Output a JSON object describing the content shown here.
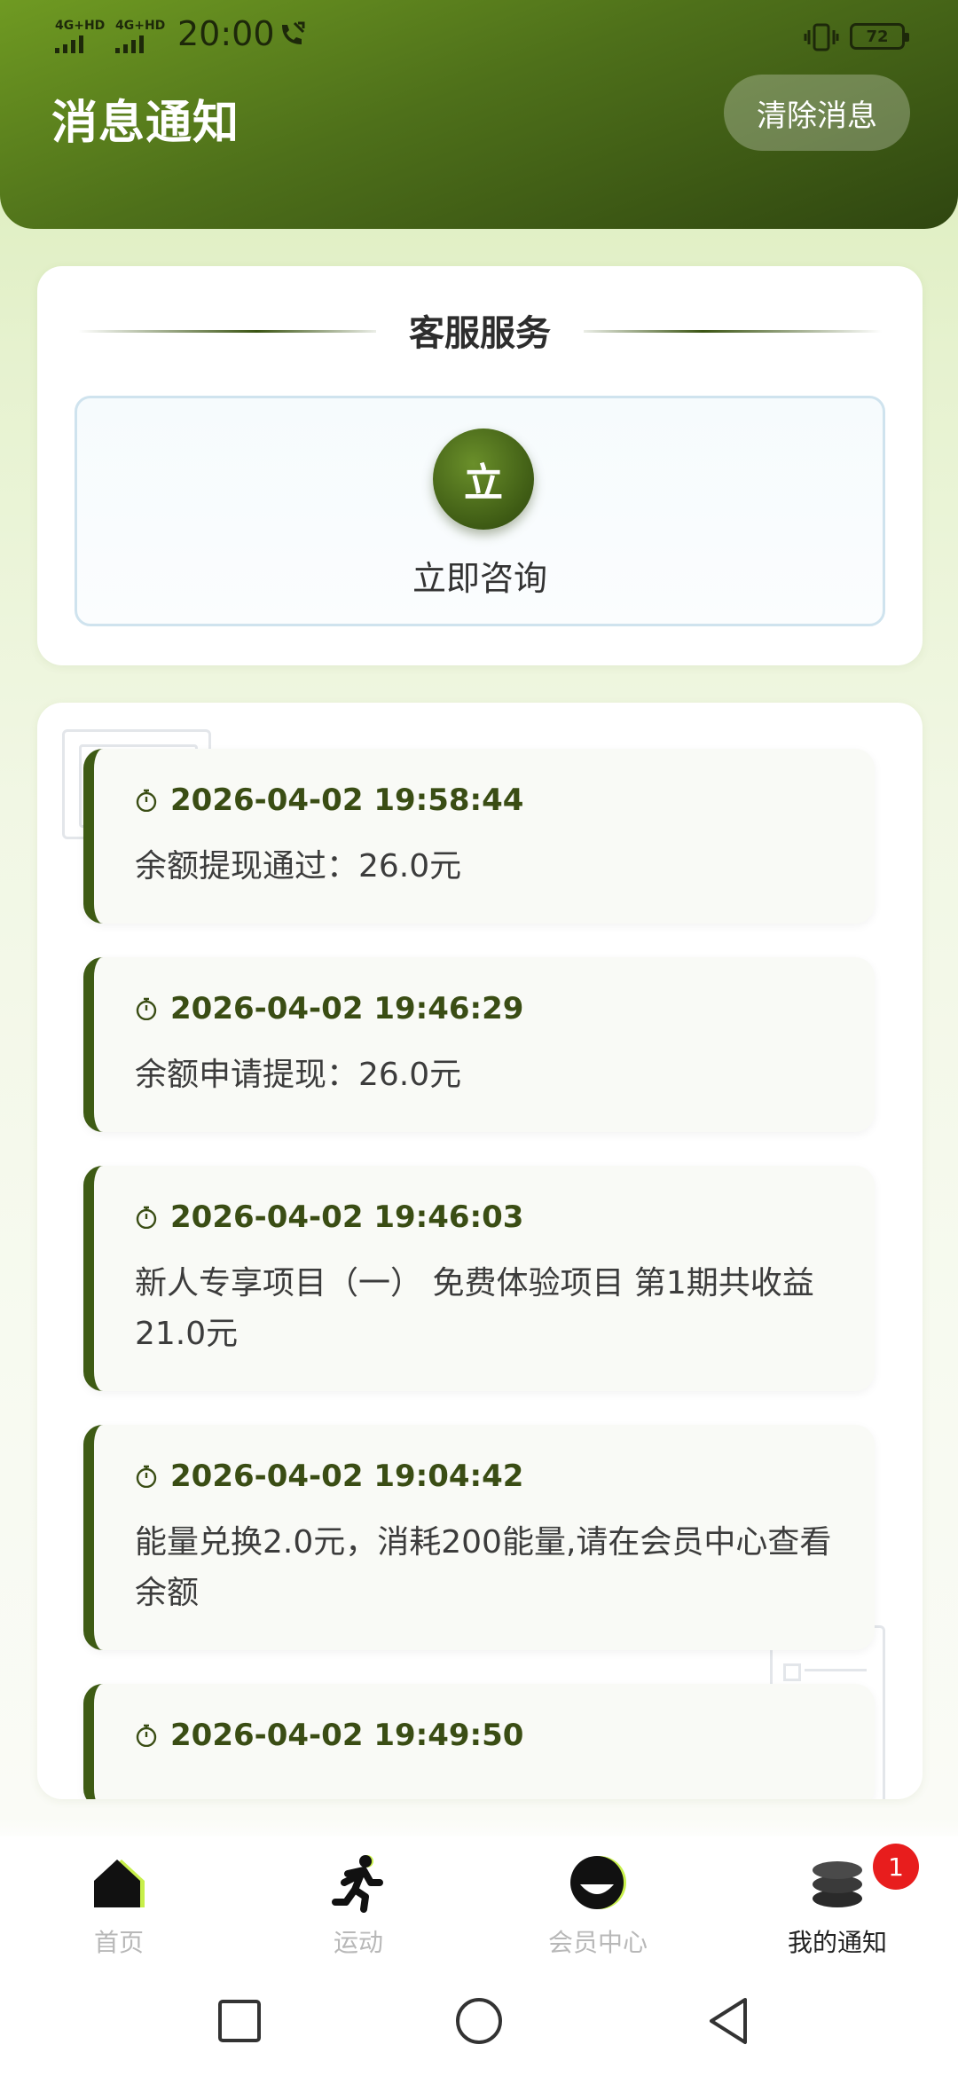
{
  "status_bar": {
    "network_1": "4G+HD",
    "network_2": "4G+HD",
    "time": "20:00",
    "battery": "72"
  },
  "header": {
    "title": "消息通知",
    "clear_button": "清除消息"
  },
  "service": {
    "section_title": "客服服务",
    "consult_icon_text": "立",
    "consult_label": "立即咨询"
  },
  "messages": [
    {
      "time": "2026-04-02 19:58:44",
      "text": "余额提现通过：26.0元"
    },
    {
      "time": "2026-04-02 19:46:29",
      "text": "余额申请提现：26.0元"
    },
    {
      "time": "2026-04-02 19:46:03",
      "text": "新人专享项目（一） 免费体验项目 第1期共收益21.0元"
    },
    {
      "time": "2026-04-02 19:04:42",
      "text": "能量兑换2.0元，消耗200能量,请在会员中心查看余额"
    },
    {
      "time": "2026-04-02 19:49:50",
      "text": ""
    }
  ],
  "tabs": [
    {
      "label": "首页",
      "icon": "home-icon",
      "active": false
    },
    {
      "label": "运动",
      "icon": "running-icon",
      "active": false
    },
    {
      "label": "会员中心",
      "icon": "member-icon",
      "active": false
    },
    {
      "label": "我的通知",
      "icon": "notification-stack-icon",
      "active": true,
      "badge": "1"
    }
  ],
  "colors": {
    "accent_dark": "#3e5b14",
    "accent_light": "#6f9a22",
    "badge": "#e81d1d"
  }
}
